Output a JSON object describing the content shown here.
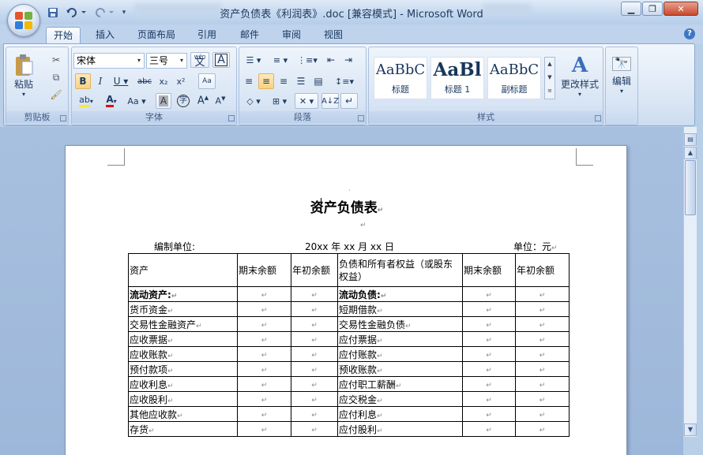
{
  "window": {
    "title": "资产负债表《利润表》.doc [兼容模式] - Microsoft Word",
    "controls": [
      "minimize",
      "maximize",
      "close"
    ]
  },
  "quick_access": {
    "icons": [
      "save-icon",
      "undo-icon",
      "redo-icon",
      "customize-icon"
    ]
  },
  "tabs": [
    "开始",
    "插入",
    "页面布局",
    "引用",
    "邮件",
    "审阅",
    "视图"
  ],
  "active_tab": "开始",
  "ribbon": {
    "clipboard": {
      "label": "剪贴板",
      "paste": "粘贴"
    },
    "font": {
      "label": "字体",
      "font_name": "宋体",
      "font_size": "三号",
      "phonetic": "wén"
    },
    "paragraph": {
      "label": "段落"
    },
    "styles": {
      "label": "样式",
      "items": [
        {
          "sample": "AaBbC",
          "name": "标题"
        },
        {
          "sample": "AaBl",
          "name": "标题 1"
        },
        {
          "sample": "AaBbC",
          "name": "副标题"
        }
      ],
      "change": "更改样式"
    },
    "editing": {
      "label": "编辑"
    }
  },
  "document": {
    "title": "资产负债表",
    "unit_label": "编制单位:",
    "date_label": "20xx 年 xx 月 xx 日",
    "currency_label": "单位：元",
    "headers": [
      "资产",
      "期末余额",
      "年初余额",
      "负债和所有者权益（或股东权益）",
      "期末余额",
      "年初余额"
    ],
    "rows": [
      [
        "流动资产:",
        "",
        "",
        "流动负债:",
        "",
        ""
      ],
      [
        "货币资金",
        "",
        "",
        "短期借款",
        "",
        ""
      ],
      [
        "交易性金融资产",
        "",
        "",
        "交易性金融负债",
        "",
        ""
      ],
      [
        "应收票据",
        "",
        "",
        "应付票据",
        "",
        ""
      ],
      [
        "应收账款",
        "",
        "",
        "应付账款",
        "",
        ""
      ],
      [
        "预付款项",
        "",
        "",
        "预收账款",
        "",
        ""
      ],
      [
        "应收利息",
        "",
        "",
        "应付职工薪酬",
        "",
        ""
      ],
      [
        "应收股利",
        "",
        "",
        "应交税金",
        "",
        ""
      ],
      [
        "其他应收款",
        "",
        "",
        "应付利息",
        "",
        ""
      ],
      [
        "存货",
        "",
        "",
        "应付股利",
        "",
        ""
      ]
    ]
  },
  "colors": {
    "accent": "#4a7bbf",
    "ribbon_bg": "#dbe7f5",
    "doc_bg": "#9fb8da"
  }
}
